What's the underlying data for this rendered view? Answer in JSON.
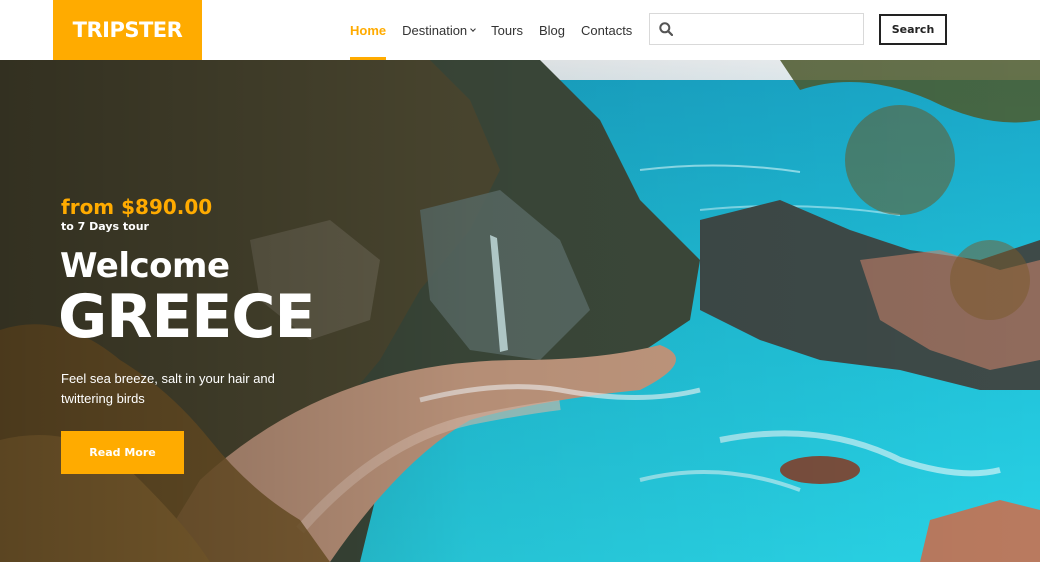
{
  "brand": {
    "name": "TRIPSTER",
    "color": "#ffab00"
  },
  "nav": {
    "items": [
      {
        "label": "Home",
        "active": true
      },
      {
        "label": "Destination",
        "has_dropdown": true
      },
      {
        "label": "Tours"
      },
      {
        "label": "Blog"
      },
      {
        "label": "Contacts"
      }
    ]
  },
  "search": {
    "placeholder": "",
    "value": "",
    "button_label": "Search",
    "icon": "search-icon"
  },
  "hero": {
    "price": "from $890.00",
    "duration": "to 7 Days tour",
    "welcome": "Welcome",
    "destination": "GREECE",
    "tagline": "Feel sea breeze, salt in your hair and twittering birds",
    "cta_label": "Read More"
  },
  "colors": {
    "accent": "#ffab00",
    "sea": "#1fc3d8",
    "dark": "#222222"
  }
}
